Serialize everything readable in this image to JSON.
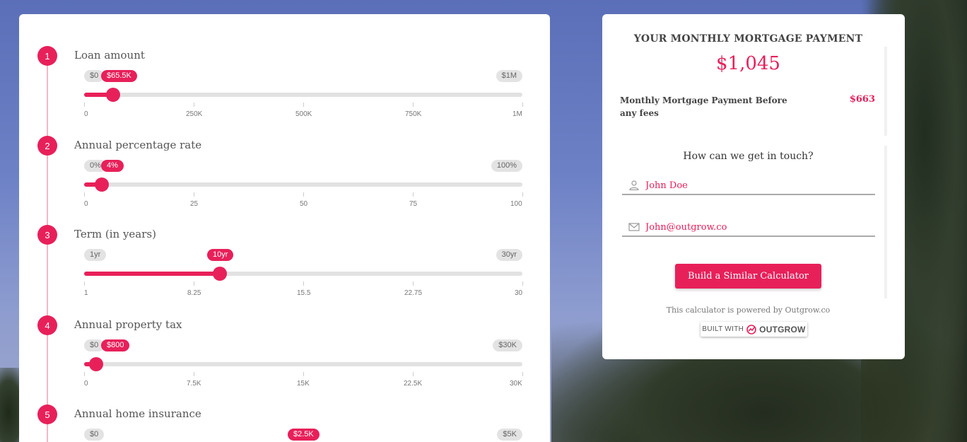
{
  "questions": [
    {
      "number": "1",
      "title": "Loan amount",
      "min_label": "$0",
      "max_label": "$1M",
      "value_label": "$65.5K",
      "value_fraction": 0.0655,
      "ticks": [
        "0",
        "250K",
        "500K",
        "750K",
        "1M"
      ]
    },
    {
      "number": "2",
      "title": "Annual percentage rate",
      "min_label": "0%",
      "max_label": "100%",
      "value_label": "4%",
      "value_fraction": 0.04,
      "ticks": [
        "0",
        "25",
        "50",
        "75",
        "100"
      ]
    },
    {
      "number": "3",
      "title": "Term (in years)",
      "min_label": "1yr",
      "max_label": "30yr",
      "value_label": "10yr",
      "value_fraction": 0.3103,
      "ticks": [
        "1",
        "8.25",
        "15.5",
        "22.75",
        "30"
      ]
    },
    {
      "number": "4",
      "title": "Annual property tax",
      "min_label": "$0",
      "max_label": "$30K",
      "value_label": "$800",
      "value_fraction": 0.0267,
      "ticks": [
        "0",
        "7.5K",
        "15K",
        "22.5K",
        "30K"
      ]
    },
    {
      "number": "5",
      "title": "Annual home insurance",
      "min_label": "$0",
      "max_label": "$5K",
      "value_label": "$2.5K",
      "value_fraction": 0.5,
      "ticks": []
    }
  ],
  "result": {
    "title": "YOUR MONTHLY MORTGAGE PAYMENT",
    "value": "$1,045",
    "breakdown_label": "Monthly Mortgage Payment Before any fees",
    "breakdown_value": "$663"
  },
  "contact": {
    "title": "How can we get in touch?",
    "name_value": "John Doe",
    "email_value": "John@outgrow.co",
    "name_icon": "user-icon",
    "email_icon": "mail-icon"
  },
  "cta": {
    "label": "Build a Similar Calculator"
  },
  "footer": {
    "powered_text": "This calculator is powered by Outgrow.co",
    "badge_built": "BUILT WITH",
    "badge_brand": "OUTGROW"
  },
  "colors": {
    "accent": "#e8205a",
    "track": "#e2e2e2"
  }
}
